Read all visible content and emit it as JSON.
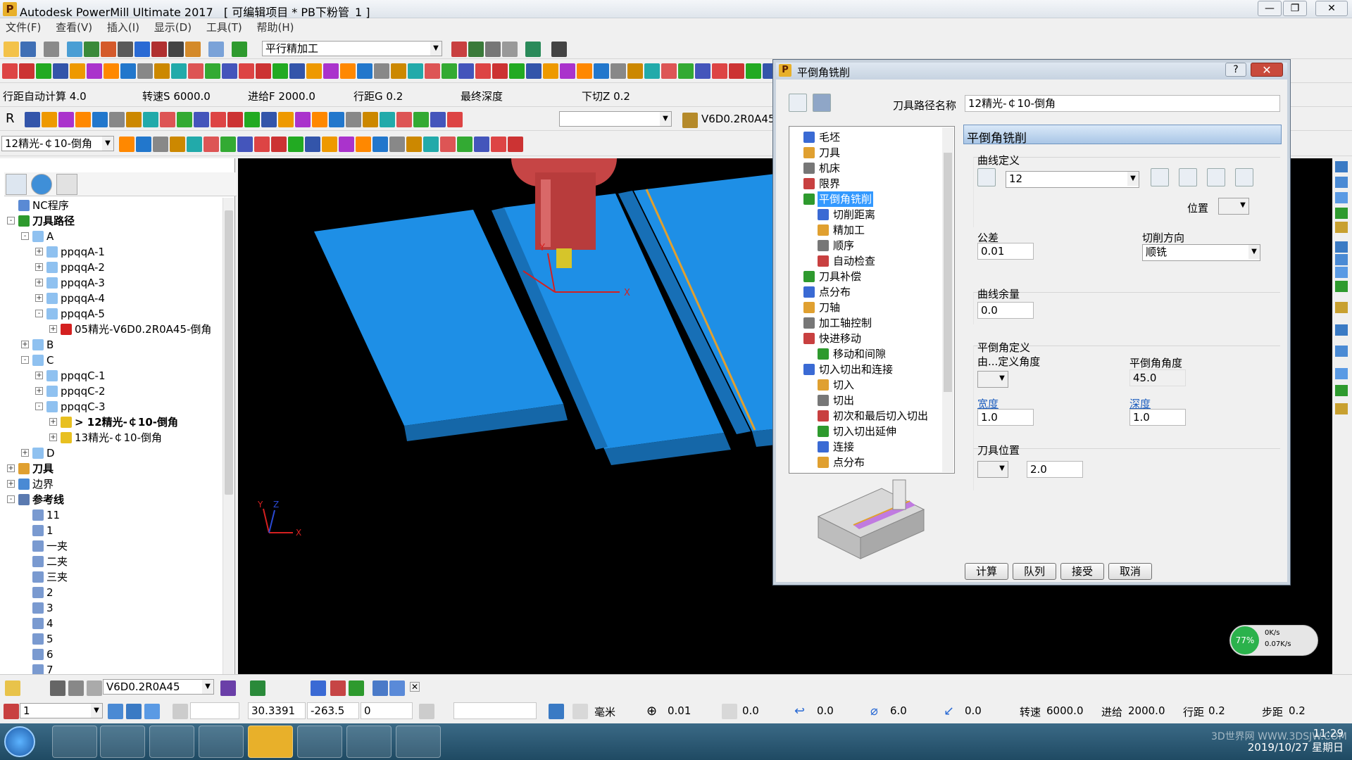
{
  "titlebar": {
    "app_title": "Autodesk PowerMill Ultimate 2017",
    "project": "[ 可编辑项目 * PB下粉管_1 ]",
    "logo": "P"
  },
  "menu": [
    "文件(F)",
    "查看(V)",
    "插入(I)",
    "显示(D)",
    "工具(T)",
    "帮助(H)"
  ],
  "toolbar1": {
    "strategy_combo": "平行精加工"
  },
  "params_row": {
    "items": [
      {
        "label": "行距自动计算",
        "value": "4.0"
      },
      {
        "label": "转速S",
        "value": "6000.0"
      },
      {
        "label": "进给F",
        "value": "2000.0"
      },
      {
        "label": "行距G",
        "value": "0.2"
      },
      {
        "label": "最终深度",
        "value": ""
      },
      {
        "label": "下切Z",
        "value": "0.2"
      }
    ]
  },
  "toolbar4": {
    "letter": "R",
    "tool_name": "V6D0.2R0A45"
  },
  "toolbar5": {
    "toolpath_combo": "12精光-￠10-倒角"
  },
  "tree": {
    "rows": [
      {
        "level": 0,
        "label": "NC程序",
        "icon": "nc-program-icon",
        "exp": ""
      },
      {
        "level": 0,
        "label": "刀具路径",
        "icon": "toolpath-icon",
        "exp": "-",
        "bold": true
      },
      {
        "level": 1,
        "label": "A",
        "icon": "folder-icon",
        "exp": "-"
      },
      {
        "level": 2,
        "label": "ppqqA-1",
        "icon": "folder-icon",
        "exp": "+"
      },
      {
        "level": 2,
        "label": "ppqqA-2",
        "icon": "folder-icon",
        "exp": "+"
      },
      {
        "level": 2,
        "label": "ppqqA-3",
        "icon": "folder-icon",
        "exp": "+"
      },
      {
        "level": 2,
        "label": "ppqqA-4",
        "icon": "folder-icon",
        "exp": "+"
      },
      {
        "level": 2,
        "label": "ppqqA-5",
        "icon": "folder-icon",
        "exp": "-"
      },
      {
        "level": 3,
        "label": "05精光-V6D0.2R0A45-倒角",
        "icon": "warning-icon",
        "exp": "+"
      },
      {
        "level": 1,
        "label": "B",
        "icon": "folder-icon",
        "exp": "+"
      },
      {
        "level": 1,
        "label": "C",
        "icon": "folder-icon",
        "exp": "-"
      },
      {
        "level": 2,
        "label": "ppqqC-1",
        "icon": "folder-icon",
        "exp": "+"
      },
      {
        "level": 2,
        "label": "ppqqC-2",
        "icon": "folder-icon",
        "exp": "+"
      },
      {
        "level": 2,
        "label": "ppqqC-3",
        "icon": "folder-icon",
        "exp": "-"
      },
      {
        "level": 3,
        "label": "> 12精光-￠10-倒角",
        "icon": "question-icon",
        "exp": "+",
        "bold": true
      },
      {
        "level": 3,
        "label": "13精光-￠10-倒角",
        "icon": "question-icon",
        "exp": "+"
      },
      {
        "level": 1,
        "label": "D",
        "icon": "folder-icon",
        "exp": "+"
      },
      {
        "level": 0,
        "label": "刀具",
        "icon": "tool-icon",
        "exp": "+",
        "bold": true
      },
      {
        "level": 0,
        "label": "边界",
        "icon": "boundary-icon",
        "exp": "+"
      },
      {
        "level": 0,
        "label": "参考线",
        "icon": "pattern-icon",
        "exp": "-",
        "bold": true
      },
      {
        "level": 1,
        "label": "11",
        "icon": "pattern-item-icon",
        "exp": "",
        "leaf": true
      },
      {
        "level": 1,
        "label": "1",
        "icon": "pattern-item-icon",
        "exp": "",
        "leaf": true
      },
      {
        "level": 1,
        "label": "一夹",
        "icon": "pattern-item-icon",
        "exp": "",
        "leaf": true
      },
      {
        "level": 1,
        "label": "二夹",
        "icon": "pattern-item-icon",
        "exp": "",
        "leaf": true
      },
      {
        "level": 1,
        "label": "三夹",
        "icon": "pattern-item-icon",
        "exp": "",
        "leaf": true
      },
      {
        "level": 1,
        "label": "2",
        "icon": "pattern-item-icon",
        "exp": "",
        "leaf": true
      },
      {
        "level": 1,
        "label": "3",
        "icon": "pattern-item-icon",
        "exp": "",
        "leaf": true
      },
      {
        "level": 1,
        "label": "4",
        "icon": "pattern-item-icon",
        "exp": "",
        "leaf": true
      },
      {
        "level": 1,
        "label": "5",
        "icon": "pattern-item-icon",
        "exp": "",
        "leaf": true
      },
      {
        "level": 1,
        "label": "6",
        "icon": "pattern-item-icon",
        "exp": "",
        "leaf": true
      },
      {
        "level": 1,
        "label": "7",
        "icon": "pattern-item-icon",
        "exp": "",
        "leaf": true
      }
    ]
  },
  "viewport": {
    "axis_labels": {
      "x": "X",
      "y": "Y",
      "z": "Z"
    },
    "colors": {
      "background": "#000000",
      "part": "#1e8fe6",
      "part_dark": "#1567a8",
      "tool": "#c64545",
      "toolpath": "#e0a030",
      "tip": "#d6c52a"
    }
  },
  "dialog": {
    "title": "平倒角铣削",
    "help": "?",
    "close": "✕",
    "toolpath_name_label": "刀具路径名称",
    "toolpath_name_value": "12精光-￠10-倒角",
    "section_header": "平倒角铣削",
    "tree": [
      {
        "level": 0,
        "label": "毛坯",
        "icon": "block-icon"
      },
      {
        "level": 0,
        "label": "刀具",
        "icon": "tool-icon"
      },
      {
        "level": 0,
        "label": "机床",
        "icon": "machine-icon"
      },
      {
        "level": 0,
        "label": "限界",
        "icon": "limit-icon"
      },
      {
        "level": 0,
        "label": "平倒角铣削",
        "icon": "chamfer-icon",
        "selected": true,
        "exp": "-"
      },
      {
        "level": 1,
        "label": "切削距离",
        "icon": "cut-distance-icon"
      },
      {
        "level": 1,
        "label": "精加工",
        "icon": "finishing-icon"
      },
      {
        "level": 1,
        "label": "顺序",
        "icon": "order-icon"
      },
      {
        "level": 1,
        "label": "自动检查",
        "icon": "auto-check-icon"
      },
      {
        "level": 0,
        "label": "刀具补偿",
        "icon": "compensation-icon"
      },
      {
        "level": 0,
        "label": "点分布",
        "icon": "point-dist-icon"
      },
      {
        "level": 0,
        "label": "刀轴",
        "icon": "tool-axis-icon"
      },
      {
        "level": 0,
        "label": "加工轴控制",
        "icon": "axis-control-icon"
      },
      {
        "level": 0,
        "label": "快进移动",
        "icon": "rapid-move-icon",
        "exp": "-"
      },
      {
        "level": 1,
        "label": "移动和间隙",
        "icon": "move-gap-icon"
      },
      {
        "level": 0,
        "label": "切入切出和连接",
        "icon": "leads-icon",
        "exp": "-"
      },
      {
        "level": 1,
        "label": "切入",
        "icon": "lead-in-icon"
      },
      {
        "level": 1,
        "label": "切出",
        "icon": "lead-out-icon"
      },
      {
        "level": 1,
        "label": "初次和最后切入切出",
        "icon": "first-last-icon"
      },
      {
        "level": 1,
        "label": "切入切出延伸",
        "icon": "extension-icon"
      },
      {
        "level": 1,
        "label": "连接",
        "icon": "link-icon"
      },
      {
        "level": 1,
        "label": "点分布",
        "icon": "point-dist-icon"
      }
    ],
    "curve_definition_label": "曲线定义",
    "curve_value": "12",
    "position_label": "位置",
    "tolerance_label": "公差",
    "tolerance_value": "0.01",
    "cut_direction_label": "切削方向",
    "cut_direction_value": "顺铣",
    "curve_thickness_label": "曲线余量",
    "curve_thickness_value": "0.0",
    "chamfer_def_label": "平倒角定义",
    "defined_by_label": "由...定义角度",
    "chamfer_angle_label": "平倒角角度",
    "chamfer_angle_value": "45.0",
    "width_label": "宽度",
    "width_value": "1.0",
    "depth_label": "深度",
    "depth_value": "1.0",
    "tool_position_label": "刀具位置",
    "tool_position_value": "2.0",
    "buttons": {
      "calculate": "计算",
      "queue": "队列",
      "accept": "接受",
      "cancel": "取消"
    }
  },
  "bottom1": {
    "tool_combo": "V6D0.2R0A45"
  },
  "bottom2": {
    "workplane": "1",
    "x": "30.3391",
    "y": "-263.5",
    "z": "0",
    "units": "毫米",
    "tol": "0.01",
    "thickness": "0.0",
    "lead": "0.0",
    "diameter": "6.0",
    "stepdown": "0.0",
    "speed_label": "转速",
    "speed": "6000.0",
    "feed_label": "进给",
    "feed": "2000.0",
    "stepover_label": "行距",
    "stepover": "0.2",
    "step_label": "步距",
    "step": "0.2"
  },
  "gauge": {
    "percent": "77%",
    "up": "0K/s",
    "down": "0.07K/s"
  },
  "clock": {
    "time": "11:29",
    "date": "2019/10/27 星期日"
  },
  "watermark": "3D世界网 WWW.3DSJW.COM"
}
